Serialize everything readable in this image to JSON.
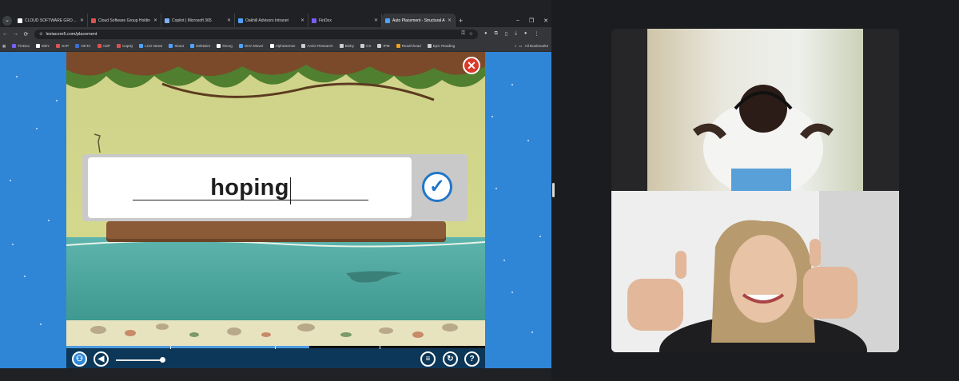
{
  "browser": {
    "tabs": [
      {
        "title": "CLOUD SOFTWARE GROUP: Fi",
        "favicon_color": "#ffffff",
        "active": false
      },
      {
        "title": "Cloud Software Group Holdin",
        "favicon_color": "#d9534f",
        "active": false
      },
      {
        "title": "Copilot | Microsoft 365",
        "favicon_color": "#7fb0ff",
        "active": false
      },
      {
        "title": "Oakhill Advisors Intranet",
        "favicon_color": "#4da3ff",
        "active": false
      },
      {
        "title": "FinDox",
        "favicon_color": "#7a5cff",
        "active": false
      },
      {
        "title": "Auto Placement - Structural A",
        "favicon_color": "#4da3ff",
        "active": true
      }
    ],
    "url": "lexiacore5.com/placement",
    "bookmarks": [
      {
        "label": "FinDox",
        "color": "#7a5cff"
      },
      {
        "label": "MDY",
        "color": "#ffffff"
      },
      {
        "label": "SAP",
        "color": "#d9534f"
      },
      {
        "label": "OKTA",
        "color": "#3b6fd8"
      },
      {
        "label": "ADP",
        "color": "#d9534f"
      },
      {
        "label": "CapIQ",
        "color": "#d9534f"
      },
      {
        "label": "LCD News",
        "color": "#4da3ff"
      },
      {
        "label": "Xtract",
        "color": "#4da3ff"
      },
      {
        "label": "Debtwire",
        "color": "#4da3ff"
      },
      {
        "label": "Reorg",
        "color": "#ffffff"
      },
      {
        "label": "OHA Mover",
        "color": "#4da3ff"
      },
      {
        "label": "AlphaSense",
        "color": "#ffffff"
      },
      {
        "label": "Arctic Research",
        "color": "#cccccc"
      },
      {
        "label": "Bixby",
        "color": "#cccccc"
      },
      {
        "label": "CS",
        "color": "#cccccc"
      },
      {
        "label": "IPM",
        "color": "#cccccc"
      },
      {
        "label": "ReadAhead",
        "color": "#f0a020"
      },
      {
        "label": "Epic Reading",
        "color": "#cccccc"
      }
    ],
    "all_bookmarks_label": "All Bookmarks"
  },
  "game": {
    "word": "hoping",
    "close_icon": "close-icon",
    "submit_icon": "check-icon",
    "progress_fraction": 0.58,
    "volume_fraction": 1.0
  },
  "video_call": {
    "participants": [
      {
        "role": "student"
      },
      {
        "role": "tutor"
      }
    ]
  }
}
